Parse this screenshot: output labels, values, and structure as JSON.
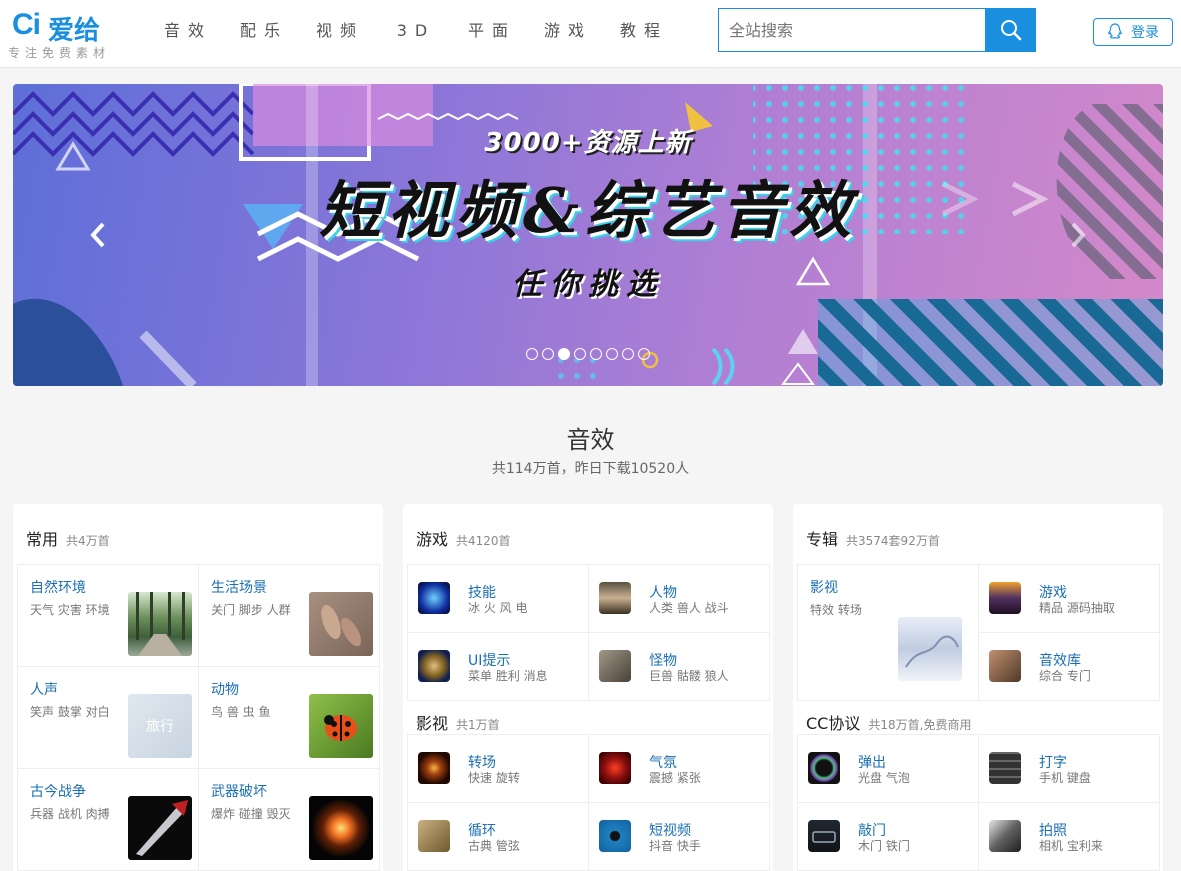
{
  "header": {
    "logo_mark": "Ci",
    "logo_name": "爱给",
    "slogan": "专注免费素材",
    "nav": [
      "音效",
      "配乐",
      "视频",
      "3D",
      "平面",
      "游戏",
      "教程"
    ],
    "search_placeholder": "全站搜索",
    "login_label": "登录"
  },
  "banner": {
    "tag": "3000+资源上新",
    "title": "短视频&综艺音效",
    "subtitle": "任你挑选",
    "slide_count": 8,
    "active_slide": 3
  },
  "section": {
    "title": "音效",
    "subtitle": "共114万首，昨日下载10520人"
  },
  "cards": {
    "common": {
      "name": "常用",
      "count": "共4万首",
      "items": [
        {
          "title": "自然环境",
          "tags": "天气 灾害 环境"
        },
        {
          "title": "生活场景",
          "tags": "关门 脚步 人群"
        },
        {
          "title": "人声",
          "tags": "笑声 鼓掌 对白"
        },
        {
          "title": "动物",
          "tags": "鸟 兽 虫 鱼"
        },
        {
          "title": "古今战争",
          "tags": "兵器 战机 肉搏"
        },
        {
          "title": "武器破坏",
          "tags": "爆炸 碰撞 毁灭"
        }
      ],
      "thumb_text": "旅行"
    },
    "game": {
      "name": "游戏",
      "count": "共4120首",
      "items": [
        {
          "title": "技能",
          "tags": "冰 火 风 电"
        },
        {
          "title": "人物",
          "tags": "人类 兽人 战斗"
        },
        {
          "title": "UI提示",
          "tags": "菜单 胜利 消息"
        },
        {
          "title": "怪物",
          "tags": "巨兽 骷髅 狼人"
        }
      ],
      "sub_name": "影视",
      "sub_count": "共1万首",
      "sub_items": [
        {
          "title": "转场",
          "tags": "快速 旋转"
        },
        {
          "title": "气氛",
          "tags": "震撼 紧张"
        },
        {
          "title": "循环",
          "tags": "古典 管弦"
        },
        {
          "title": "短视频",
          "tags": "抖音 快手"
        }
      ]
    },
    "album": {
      "name": "专辑",
      "count": "共3574套92万首",
      "feature": {
        "title": "影视",
        "tags": "特效 转场"
      },
      "items": [
        {
          "title": "游戏",
          "tags": "精品 源码抽取"
        },
        {
          "title": "音效库",
          "tags": "综合 专门"
        }
      ],
      "sub_name": "CC协议",
      "sub_count": "共18万首,免费商用",
      "sub_items": [
        {
          "title": "弹出",
          "tags": "光盘 气泡"
        },
        {
          "title": "打字",
          "tags": "手机 键盘"
        },
        {
          "title": "敲门",
          "tags": "木门 铁门"
        },
        {
          "title": "拍照",
          "tags": "相机 宝利来"
        }
      ]
    }
  }
}
